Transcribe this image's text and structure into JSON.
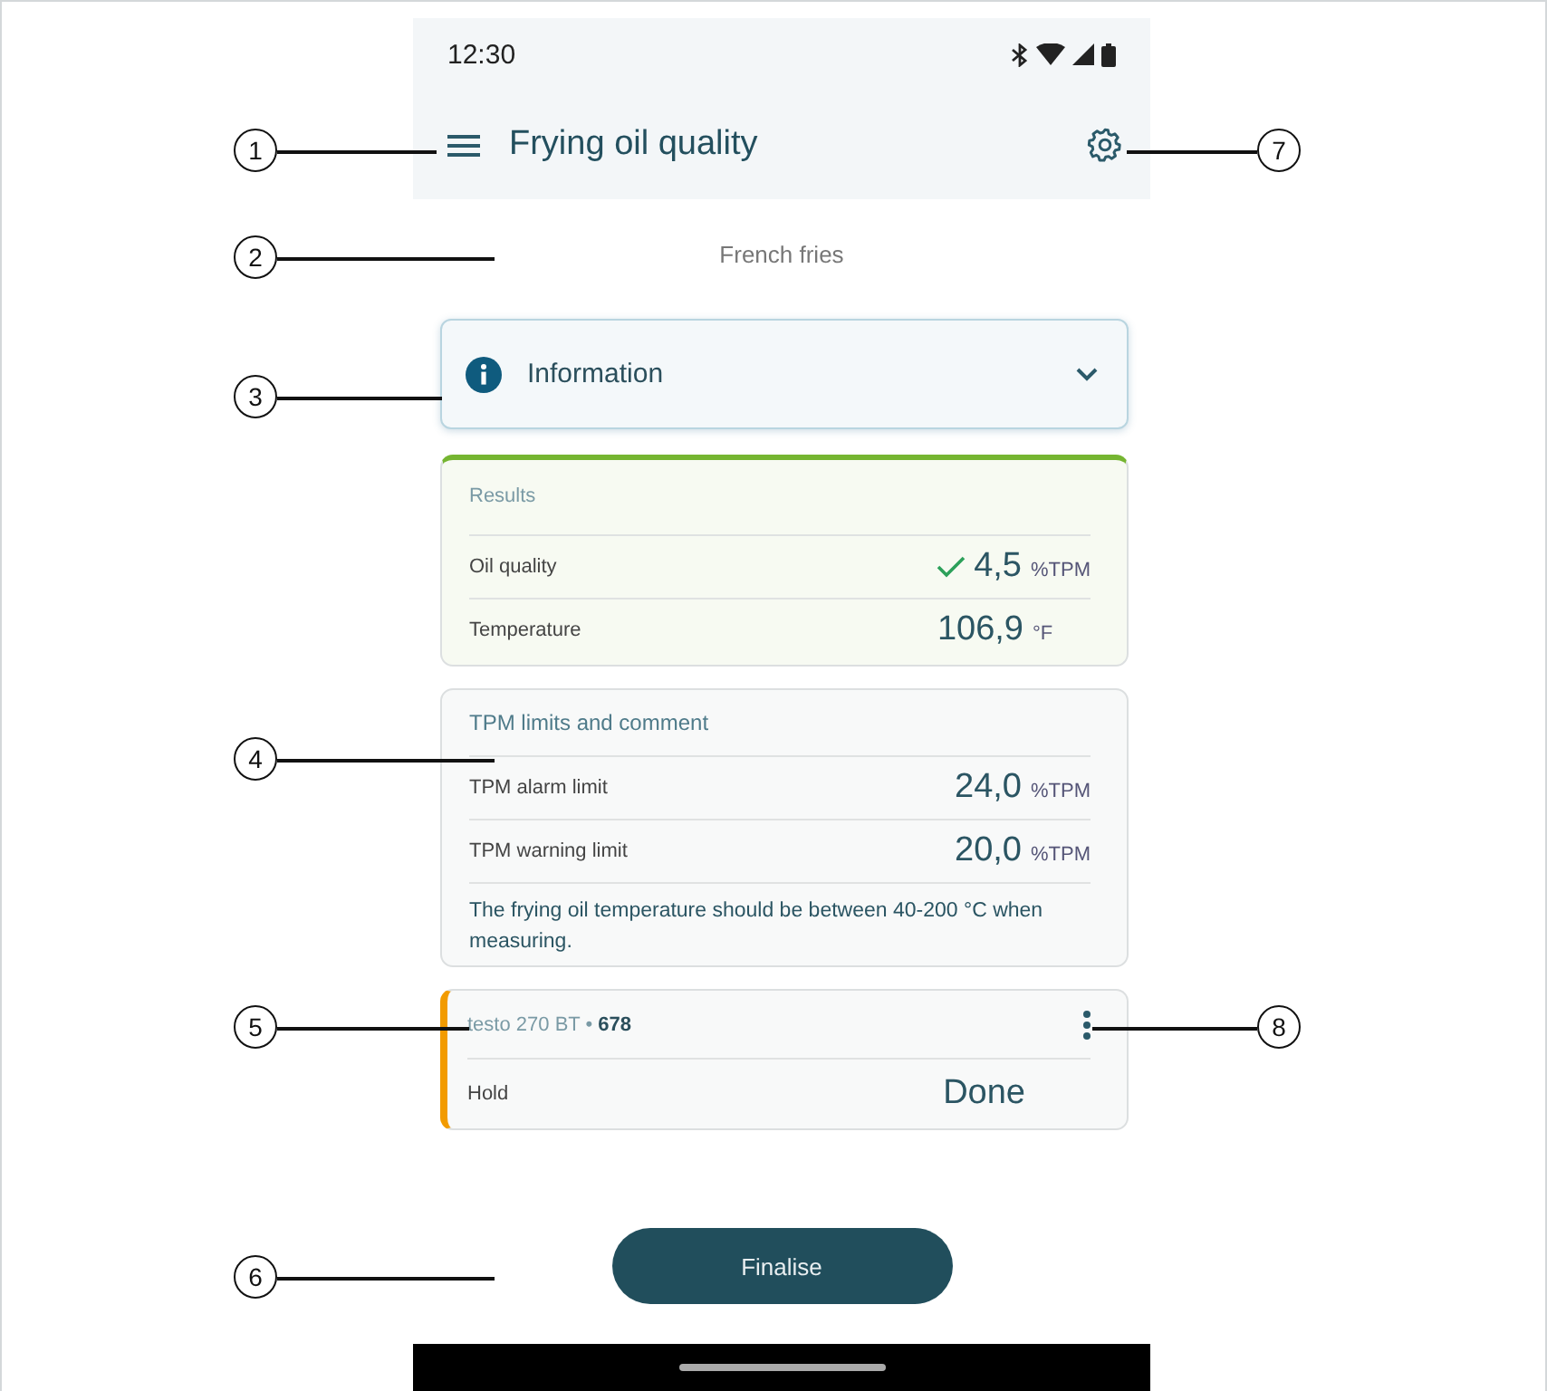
{
  "status_bar": {
    "time": "12:30"
  },
  "app_bar": {
    "title": "Frying oil quality"
  },
  "subtitle": "French fries",
  "info_panel": {
    "label": "Information",
    "expanded": false
  },
  "results": {
    "title": "Results",
    "rows": [
      {
        "label": "Oil quality",
        "value": "4,5",
        "unit": "%TPM",
        "kind": "ok"
      },
      {
        "label": "Temperature",
        "value": "106,9",
        "unit": "°F",
        "kind": "plain"
      }
    ]
  },
  "limits": {
    "title": "TPM limits and comment",
    "rows": [
      {
        "label": "TPM alarm limit",
        "value": "24,0",
        "unit": "%TPM"
      },
      {
        "label": "TPM warning limit",
        "value": "20,0",
        "unit": "%TPM"
      }
    ],
    "comment": "The frying oil temperature should be between 40-200 °C when measuring."
  },
  "device": {
    "name": "testo 270 BT • **678**",
    "rows": [
      {
        "label": "Hold",
        "value": "Done"
      }
    ]
  },
  "finalise_button": "Finalise",
  "callouts": [
    {
      "number": "1"
    },
    {
      "number": "2"
    },
    {
      "number": "3"
    },
    {
      "number": "4"
    },
    {
      "number": "5"
    },
    {
      "number": "6"
    },
    {
      "number": "7"
    },
    {
      "number": "8"
    }
  ]
}
